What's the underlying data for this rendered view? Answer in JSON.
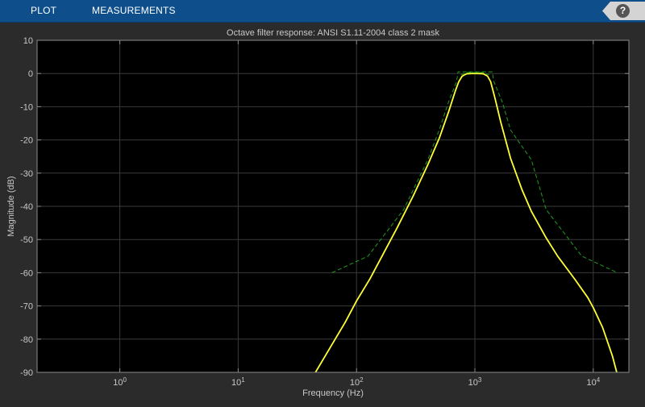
{
  "toolbar": {
    "tabs": [
      "PLOT",
      "MEASUREMENTS"
    ],
    "help_label": "?"
  },
  "colors": {
    "toolbar_bg": "#0e4f8b",
    "figure_bg": "#2b2b2b",
    "axes_bg": "#000000",
    "grid": "#3a3a3a",
    "text": "#c8c8c8",
    "response": "#ffff33",
    "mask": "#1e9e1e"
  },
  "chart_data": {
    "type": "line",
    "title": "Octave filter response: ANSI S1.11-2004 class 2 mask",
    "xlabel": "Frequency (Hz)",
    "ylabel": "Magnitude (dB)",
    "xscale": "log",
    "xlim": [
      0.2,
      20000
    ],
    "ylim": [
      -90,
      10
    ],
    "xticks": [
      {
        "value": 1,
        "base": "10",
        "exp": "0"
      },
      {
        "value": 10,
        "base": "10",
        "exp": "1"
      },
      {
        "value": 100,
        "base": "10",
        "exp": "2"
      },
      {
        "value": 1000,
        "base": "10",
        "exp": "3"
      },
      {
        "value": 10000,
        "base": "10",
        "exp": "4"
      }
    ],
    "yticks": [
      10,
      0,
      -10,
      -20,
      -30,
      -40,
      -50,
      -60,
      -70,
      -80,
      -90
    ],
    "grid": true,
    "series": [
      {
        "style": "solid",
        "color": "#ffff33",
        "x": [
          45,
          60,
          80,
          100,
          130,
          170,
          220,
          300,
          400,
          500,
          600,
          680,
          730,
          780,
          850,
          950,
          1000,
          1060,
          1180,
          1280,
          1360,
          1480,
          1650,
          2000,
          2500,
          3000,
          4000,
          5000,
          7000,
          9000,
          10000,
          12000,
          14500,
          15800
        ],
        "y": [
          -90,
          -82.5,
          -75,
          -68.5,
          -61.8,
          -54,
          -46.5,
          -37,
          -27.5,
          -19.5,
          -11.5,
          -5.5,
          -2.5,
          -0.8,
          -0.1,
          0,
          0,
          0,
          -0.1,
          -0.8,
          -2.5,
          -7.5,
          -14.5,
          -25.5,
          -35,
          -41.5,
          -49.5,
          -55,
          -62,
          -67.5,
          -70.5,
          -76.5,
          -85,
          -90
        ]
      },
      {
        "style": "dashed",
        "color": "#1e9e1e",
        "x": [
          62,
          125,
          250,
          400,
          500,
          600,
          700,
          720,
          1400,
          1450,
          1700,
          2000,
          3000,
          4000,
          8000,
          16000
        ],
        "y": [
          -60,
          -55,
          -41,
          -26,
          -17,
          -8.5,
          -2.5,
          0.5,
          0.5,
          -2.5,
          -8.5,
          -17,
          -26,
          -41,
          -55,
          -60
        ]
      },
      {
        "style": "dashed",
        "color": "#1e9e1e",
        "x": [
          760,
          800,
          850,
          1000,
          1180,
          1250,
          1320
        ],
        "y": [
          -0.3,
          -0.2,
          0.3,
          0.3,
          0.3,
          -0.2,
          -0.3
        ]
      }
    ]
  }
}
